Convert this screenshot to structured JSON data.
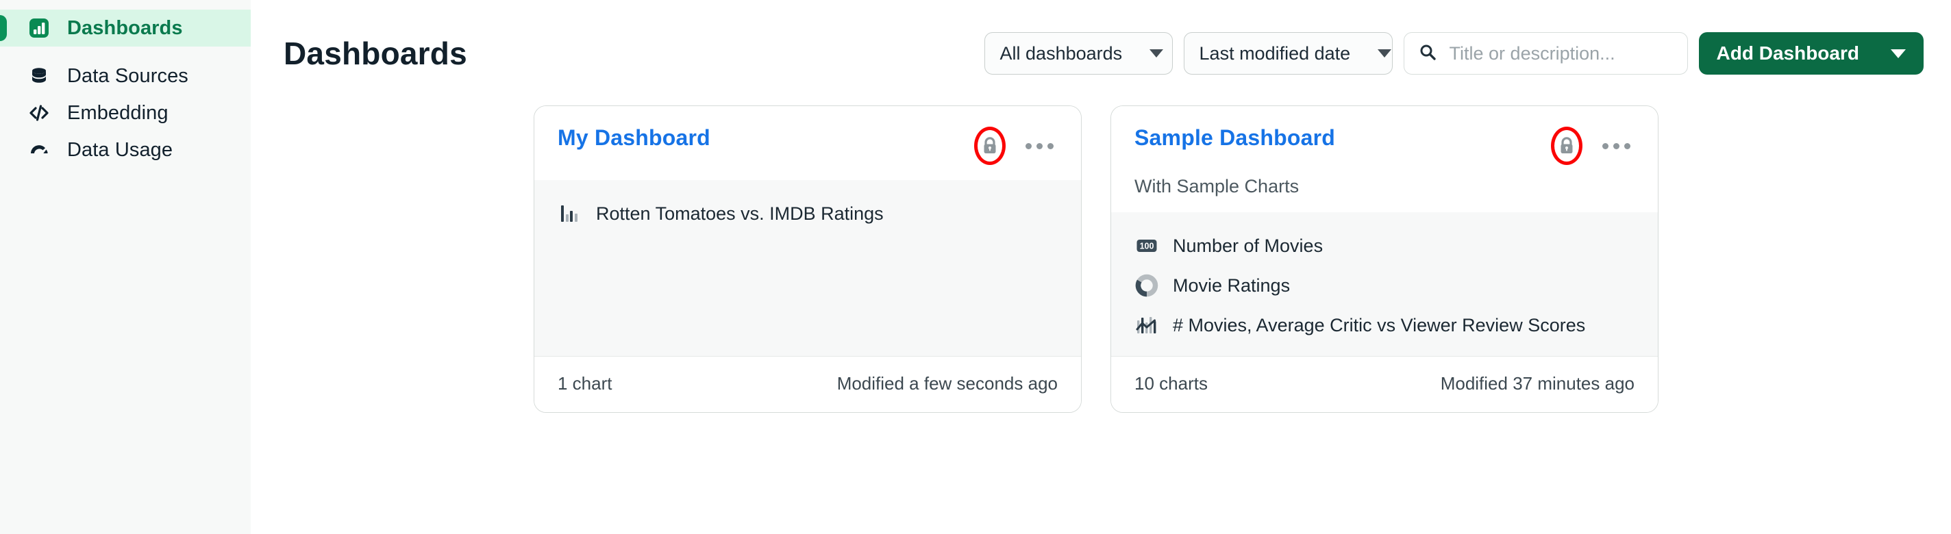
{
  "sidebar": {
    "items": [
      {
        "label": "Dashboards",
        "icon": "bar-chart-icon",
        "active": true
      },
      {
        "label": "Data Sources",
        "icon": "database-icon",
        "active": false
      },
      {
        "label": "Embedding",
        "icon": "code-icon",
        "active": false
      },
      {
        "label": "Data Usage",
        "icon": "gauge-icon",
        "active": false
      }
    ]
  },
  "header": {
    "title": "Dashboards",
    "scope_filter": {
      "value": "All dashboards",
      "icon": "chevron-down-icon"
    },
    "sort_filter": {
      "value": "Last modified date",
      "icon": "chevron-down-icon"
    },
    "search": {
      "value": "",
      "placeholder": "Title or description...",
      "icon": "search-icon"
    },
    "add_button": {
      "label": "Add Dashboard",
      "icon": "chevron-down-icon"
    }
  },
  "colors": {
    "brand_green": "#0b6b44",
    "active_nav_bg": "#d9f6e7",
    "active_nav_text": "#0a7a4e",
    "card_title_link": "#1673e6",
    "annotation_red": "#fb0505",
    "sidebar_bg": "#f7f9f8",
    "card_body_bg": "#f7f8f8"
  },
  "cards": [
    {
      "title": "My Dashboard",
      "description": "",
      "lock": {
        "icon": "lock-icon",
        "annotated": true
      },
      "menu": {
        "icon": "ellipsis-icon"
      },
      "charts": [
        {
          "label": "Rotten Tomatoes vs. IMDB Ratings",
          "icon": "bar-chart-icon"
        }
      ],
      "chart_count": "1 chart",
      "modified": "Modified a few seconds ago"
    },
    {
      "title": "Sample Dashboard",
      "description": "With Sample Charts",
      "lock": {
        "icon": "lock-icon",
        "annotated": true
      },
      "menu": {
        "icon": "ellipsis-icon"
      },
      "charts": [
        {
          "label": "Number of Movies",
          "icon": "number-badge-icon"
        },
        {
          "label": "Movie Ratings",
          "icon": "donut-chart-icon"
        },
        {
          "label": "# Movies, Average Critic vs Viewer Review Scores",
          "icon": "combo-chart-icon"
        }
      ],
      "chart_count": "10 charts",
      "modified": "Modified 37 minutes ago"
    }
  ]
}
